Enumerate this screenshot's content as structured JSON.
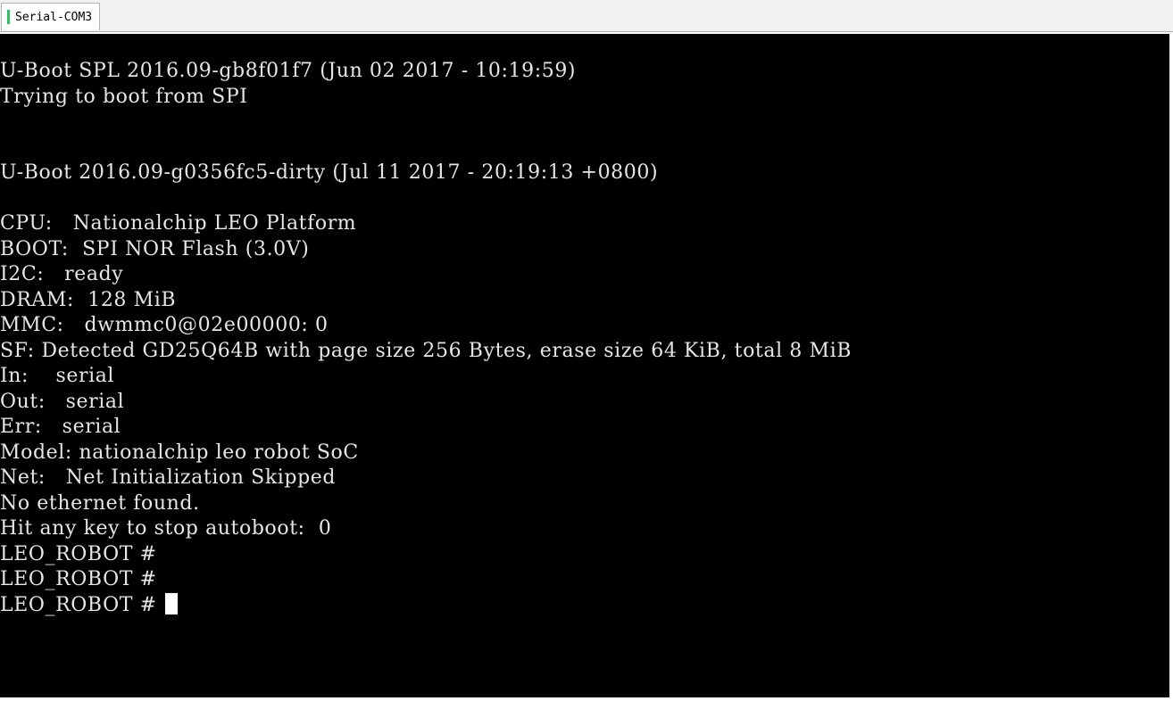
{
  "tab": {
    "label": "Serial-COM3",
    "indicator_color": "#22c55e"
  },
  "terminal": {
    "background": "#000000",
    "foreground": "#e6e6e6",
    "lines": [
      "U-Boot SPL 2016.09-gb8f01f7 (Jun 02 2017 - 10:19:59)",
      "Trying to boot from SPI",
      "",
      "",
      "U-Boot 2016.09-g0356fc5-dirty (Jul 11 2017 - 20:19:13 +0800)",
      "",
      "CPU:   Nationalchip LEO Platform",
      "BOOT:  SPI NOR Flash (3.0V)",
      "I2C:   ready",
      "DRAM:  128 MiB",
      "MMC:   dwmmc0@02e00000: 0",
      "SF: Detected GD25Q64B with page size 256 Bytes, erase size 64 KiB, total 8 MiB",
      "In:    serial",
      "Out:   serial",
      "Err:   serial",
      "Model: nationalchip leo robot SoC",
      "Net:   Net Initialization Skipped",
      "No ethernet found.",
      "Hit any key to stop autoboot:  0",
      "LEO_ROBOT #",
      "LEO_ROBOT #",
      "LEO_ROBOT # "
    ],
    "cursor_visible": true
  }
}
